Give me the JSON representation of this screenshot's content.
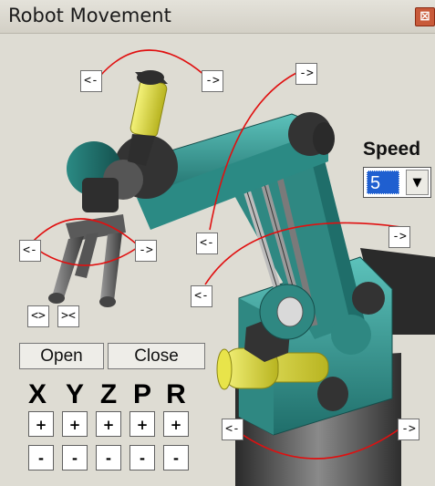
{
  "window": {
    "title": "Robot Movement",
    "close_glyph": "⊠"
  },
  "rotate_buttons": {
    "top_left": "<-",
    "top_right": "->",
    "upper_right": "->",
    "middle_left": "<-",
    "middle_right": "->",
    "gripper_left": "<-",
    "gripper_right": "->",
    "lower_left": "<-",
    "base_left": "<-",
    "base_right": "->"
  },
  "gripper_buttons": {
    "widen": "<>",
    "narrow": "><"
  },
  "hand": {
    "open_label": "Open",
    "close_label": "Close"
  },
  "axes": {
    "labels": [
      "X",
      "Y",
      "Z",
      "P",
      "R"
    ],
    "plus": "+",
    "minus": "-"
  },
  "speed": {
    "label": "Speed",
    "selected_value": "5",
    "arrow_glyph": "▼"
  },
  "colors": {
    "arm_teal": "#3a9e98",
    "gripper_yellow": "#e8e44a",
    "arc_red": "#e01010",
    "select_highlight": "#1f5fd0"
  }
}
